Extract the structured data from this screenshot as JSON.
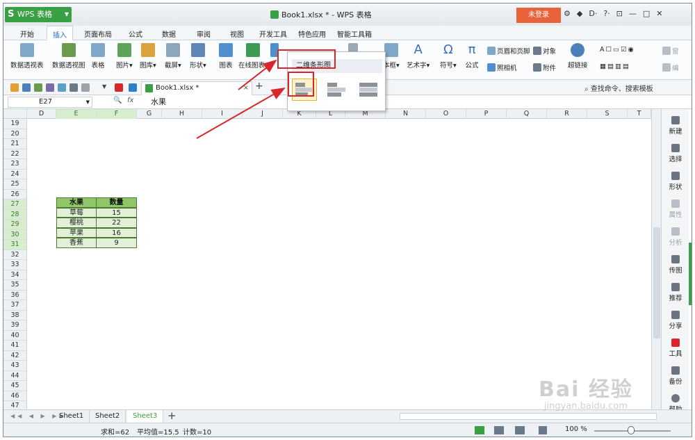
{
  "app": {
    "name": "WPS 表格",
    "title": "Book1.xlsx * - WPS 表格",
    "login_label": "未登录"
  },
  "title_icons": [
    "⚙",
    "◆",
    "D·",
    "?·"
  ],
  "window_controls": {
    "pin": "⊡",
    "minimize": "—",
    "maximize": "□",
    "close": "✕"
  },
  "menu": {
    "items": [
      "开始",
      "插入",
      "页面布局",
      "公式",
      "数据",
      "审阅",
      "视图",
      "开发工具",
      "特色应用",
      "智能工具箱"
    ],
    "active": "插入"
  },
  "ribbon": {
    "pivot_table": "数据透视表",
    "pivot_chart": "数据透视图",
    "table": "表格",
    "picture": "图片",
    "gallery": "图库",
    "screenshot": "截屏",
    "shapes": "形状",
    "chart": "图表",
    "online_chart": "在线图表",
    "textbox": "本框",
    "art_text": "艺术字",
    "symbol": "符号",
    "formula": "公式",
    "header_footer": "页眉和页脚",
    "object": "对象",
    "camera": "照相机",
    "attachment": "附件",
    "hyperlink": "超链接",
    "window": "窗",
    "edit": "编"
  },
  "quickbar": {
    "doc_tab": "Book1.xlsx *",
    "close": "×",
    "new_tab": "+",
    "search_text": "查找命令、搜索模板"
  },
  "formula_bar": {
    "cell_ref": "E27",
    "zoom_icon": "🔍",
    "fx": "fx",
    "value": "水果"
  },
  "columns": [
    "D",
    "E",
    "F",
    "G",
    "H",
    "I",
    "J",
    "K",
    "L",
    "M",
    "N",
    "O",
    "P",
    "Q",
    "R",
    "S",
    "T"
  ],
  "selected_columns": [
    "E",
    "F"
  ],
  "rows": [
    "19",
    "20",
    "21",
    "22",
    "23",
    "24",
    "25",
    "26",
    "27",
    "28",
    "29",
    "30",
    "31",
    "32",
    "33",
    "34",
    "35",
    "36",
    "37",
    "38",
    "39",
    "40",
    "41",
    "42",
    "43",
    "44",
    "45",
    "46",
    "47"
  ],
  "selected_rows": [
    "27",
    "28",
    "29",
    "30",
    "31"
  ],
  "table_data": {
    "headers": [
      "水果",
      "数量"
    ],
    "rows": [
      [
        "草莓",
        "15"
      ],
      [
        "樱桃",
        "22"
      ],
      [
        "苹果",
        "16"
      ],
      [
        "香蕉",
        "9"
      ]
    ]
  },
  "dropdown": {
    "label": "二维条形图",
    "selected_index": 0
  },
  "right_panel": [
    {
      "label": "新建",
      "dim": false
    },
    {
      "label": "选择",
      "dim": false
    },
    {
      "label": "形状",
      "dim": false
    },
    {
      "label": "属性",
      "dim": true
    },
    {
      "label": "分析",
      "dim": true
    },
    {
      "label": "传图",
      "dim": false
    },
    {
      "label": "推荐",
      "dim": false
    },
    {
      "label": "分享",
      "dim": false
    },
    {
      "label": "工具",
      "dim": false
    },
    {
      "label": "备份",
      "dim": false
    },
    {
      "label": "帮助",
      "dim": false
    }
  ],
  "sheets": {
    "tabs": [
      "Sheet1",
      "Sheet2",
      "Sheet3"
    ],
    "active": "Sheet3",
    "add": "+"
  },
  "status": {
    "sum": "求和=62",
    "average": "平均值=15.5",
    "count": "计数=10",
    "zoom": "100 %"
  },
  "watermark": {
    "main": "Bai 经验",
    "sub": "jingyan.baidu.com"
  },
  "colors": {
    "brand_green": "#3aa044",
    "login_orange": "#e8623a",
    "header_fill": "#8fc66a",
    "body_fill": "#e2f0d8",
    "annotation_red": "#d9262b"
  }
}
